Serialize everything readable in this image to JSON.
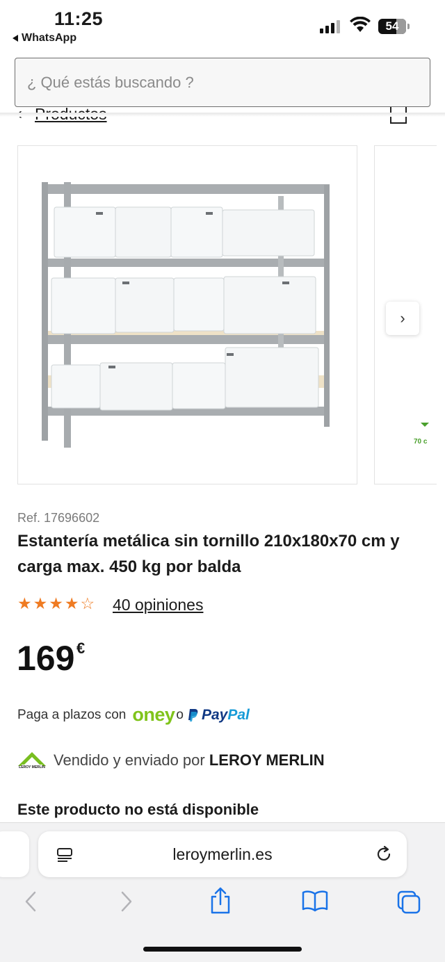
{
  "status_bar": {
    "time": "11:25",
    "back_app": "WhatsApp",
    "battery": "54"
  },
  "search": {
    "placeholder": "¿ Qué estás buscando ?"
  },
  "breadcrumb": {
    "link": "Productos"
  },
  "gallery": {
    "side_label": "70 c"
  },
  "product": {
    "ref": "Ref. 17696602",
    "title": "Estantería metálica sin tornillo 210x180x70 cm y carga max. 450 kg por balda",
    "rating_stars": 4.5,
    "reviews": "40 opiniones",
    "price": "169",
    "currency": "€",
    "installments_text": "Paga a plazos con",
    "oney": "oney",
    "or": "o",
    "paypal_1": "Pay",
    "paypal_2": "Pal",
    "seller_prefix": "Vendido y enviado por",
    "seller_name": "LEROY MERLIN",
    "availability": "Este producto no está disponible"
  },
  "browser": {
    "url": "leroymerlin.es"
  },
  "colors": {
    "accent_orange": "#ef7b22",
    "oney_green": "#80c41c",
    "paypal_dark": "#113984",
    "paypal_light": "#179bd7",
    "ios_blue": "#1a73e8"
  }
}
